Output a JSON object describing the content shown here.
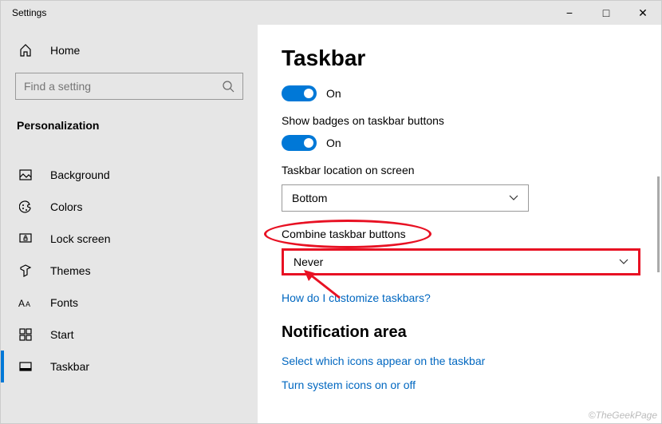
{
  "window": {
    "title": "Settings"
  },
  "titlebar": {
    "min": "−",
    "max": "□",
    "close": "✕"
  },
  "sidebar": {
    "home": "Home",
    "search_placeholder": "Find a setting",
    "section": "Personalization",
    "items": [
      "Background",
      "Colors",
      "Lock screen",
      "Themes",
      "Fonts",
      "Start",
      "Taskbar"
    ]
  },
  "content": {
    "heading": "Taskbar",
    "toggle1_label": "On",
    "badges_label": "Show badges on taskbar buttons",
    "toggle2_label": "On",
    "location_label": "Taskbar location on screen",
    "location_value": "Bottom",
    "combine_label": "Combine taskbar buttons",
    "combine_value": "Never",
    "help_link": "How do I customize taskbars?",
    "notif_heading": "Notification area",
    "notif_link1": "Select which icons appear on the taskbar",
    "notif_link2": "Turn system icons on or off"
  },
  "watermark": "©TheGeekPage"
}
